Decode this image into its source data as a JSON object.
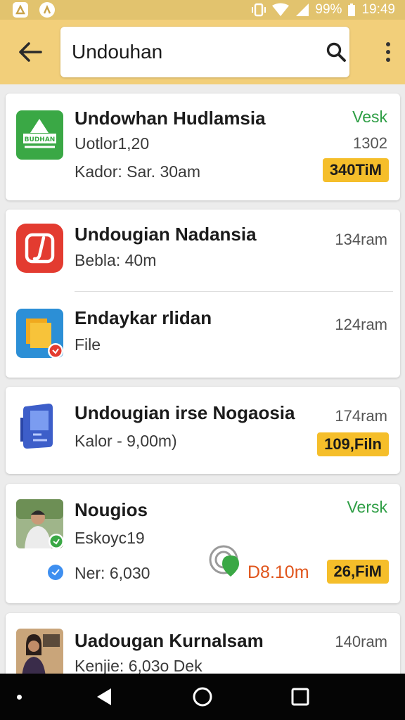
{
  "status_bar": {
    "battery": "99%",
    "time": "19:49"
  },
  "app_bar": {
    "search_value": "Undouhan"
  },
  "results": [
    {
      "title": "Undowhan Hudlamsia",
      "subtitle": "Uotlor1,20",
      "detail": "Kador: Sar. 30am",
      "status": "Vesk",
      "meta": "1302",
      "badge": "340TiM",
      "icon_text": "BUDHAN",
      "icon": "green-download-app-icon"
    },
    {
      "title": "Undougian Nadansia",
      "subtitle": "Bebla: 40m",
      "meta": "134ram",
      "icon": "red-music-app-icon"
    },
    {
      "title": "Endaykar rlidan",
      "subtitle": "File",
      "meta": "124ram",
      "icon": "folder-app-icon"
    },
    {
      "title": "Undougian irse Nogaosia",
      "subtitle": "Kalor - 9,00m)",
      "meta": "174ram",
      "badge": "109,Filn",
      "icon": "blue-card-app-icon"
    },
    {
      "title": "Nougios",
      "subtitle": "Eskoyc19",
      "detail": "Ner: 6,030",
      "status": "Versk",
      "size": "D8.10m",
      "badge": "26,FiM",
      "icon": "person-photo-app-icon"
    },
    {
      "title": "Uadougan Kurnalsam",
      "subtitle": "Kenjie: 6,03o Dek",
      "meta": "140ram",
      "icon": "woman-photo-app-icon"
    }
  ],
  "colors": {
    "app_bar": "#f2cf7a",
    "status_bar": "#e2c36e",
    "badge": "#f5be2a",
    "green": "#2e9e45",
    "orange_text": "#e0551c"
  }
}
